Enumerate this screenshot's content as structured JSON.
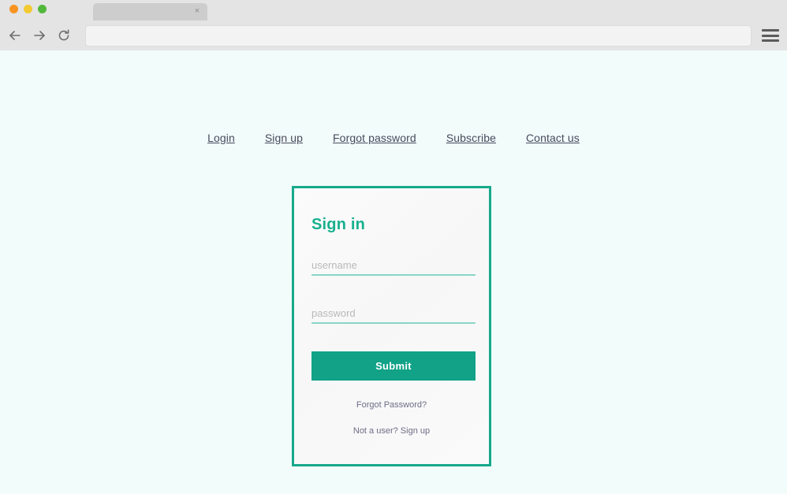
{
  "browser": {
    "traffic_lights": [
      "close",
      "minimize",
      "maximize"
    ],
    "tab": {
      "title": "",
      "close_label": "×"
    },
    "back_label": "Back",
    "forward_label": "Forward",
    "reload_label": "Reload",
    "address_value": "",
    "address_placeholder": "",
    "menu_label": "Menu",
    "colors": {
      "chrome_bg": "#e4e4e4",
      "tab_bg": "#cdcdcd",
      "dot_close": "#f79421",
      "dot_minimize": "#f4ca32",
      "dot_maximize": "#51b83b"
    }
  },
  "page": {
    "background": "#f1fcfb",
    "topnav": [
      {
        "label": "Login"
      },
      {
        "label": "Sign up"
      },
      {
        "label": "Forgot password"
      },
      {
        "label": "Subscribe"
      },
      {
        "label": "Contact us"
      }
    ]
  },
  "signin_card": {
    "title": "Sign in",
    "username": {
      "value": "",
      "placeholder": "username"
    },
    "password": {
      "value": "",
      "placeholder": "password"
    },
    "submit_label": "Submit",
    "forgot_password_label": "Forgot Password?",
    "signup_label": "Not a user? Sign up",
    "colors": {
      "accent": "#11a287",
      "border": "#16a98a",
      "title": "#17b08e",
      "underline": "#87d6c5",
      "card_bg": "#fafafa",
      "link": "#6d6d86"
    }
  }
}
